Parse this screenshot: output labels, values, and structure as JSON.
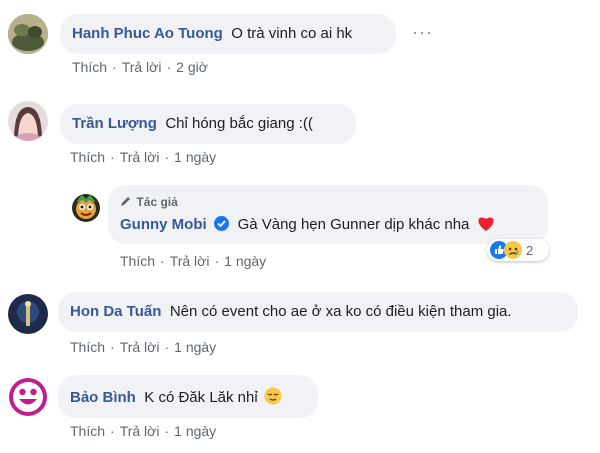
{
  "comments": [
    {
      "name": "Hanh Phuc Ao Tuong",
      "text": "O trà vinh co ai hk",
      "like": "Thích",
      "reply": "Trả lời",
      "time": "2 giờ",
      "more": "···"
    },
    {
      "name": "Trần Lượng",
      "text": "Chỉ hóng bắc giang :((",
      "like": "Thích",
      "reply": "Trả lời",
      "time": "1 ngày"
    },
    {
      "badge": "Tác giả",
      "name": "Gunny Mobi",
      "text": "Gà Vàng hẹn Gunner dịp khác nha",
      "like": "Thích",
      "reply": "Trả lời",
      "time": "1 ngày",
      "reaction_count": "2"
    },
    {
      "name": "Hon Da Tuấn",
      "text": "Nên có event cho ae ở xa ko có điều kiện tham gia.",
      "like": "Thích",
      "reply": "Trả lời",
      "time": "1 ngày"
    },
    {
      "name": "Bảo Bình",
      "text": "K có Đăk Lăk nhỉ",
      "like": "Thích",
      "reply": "Trả lời",
      "time": "1 ngày"
    }
  ],
  "separator": "·",
  "colors": {
    "name": "#385898",
    "bubble": "#f0f2f5",
    "meta": "#606770",
    "verified": "#1877f2",
    "heart": "#f33e58"
  }
}
